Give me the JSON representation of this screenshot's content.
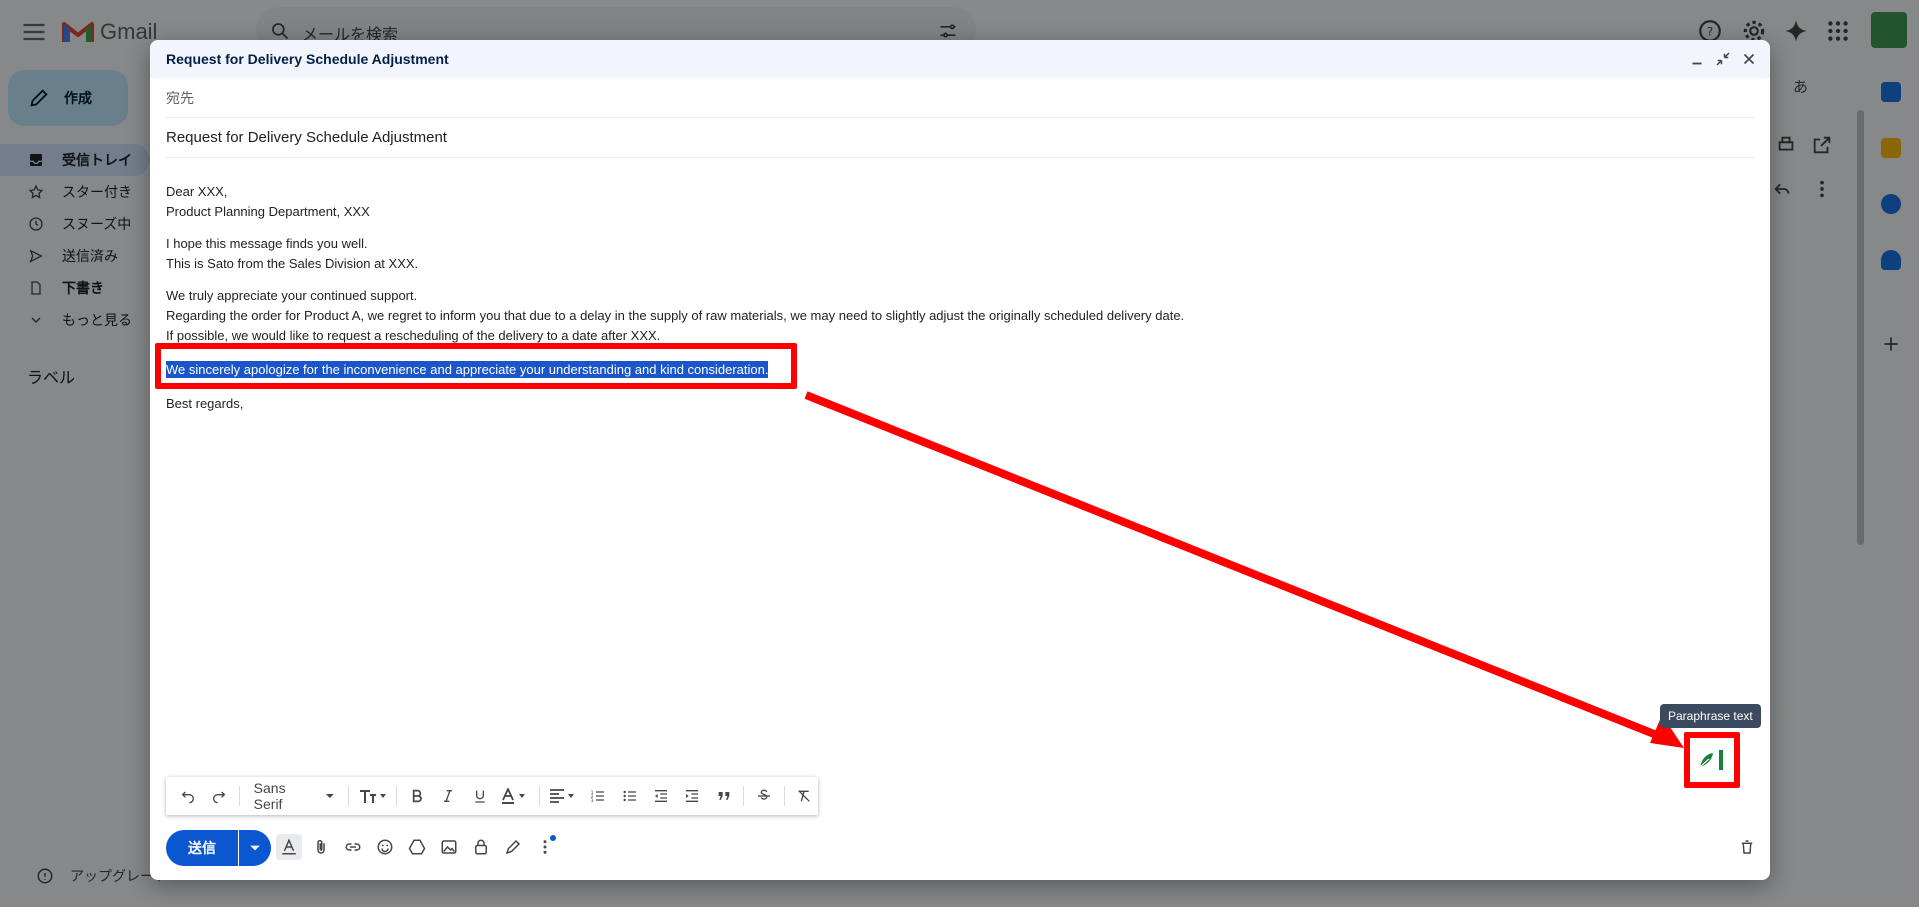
{
  "app": {
    "name": "Gmail"
  },
  "search": {
    "placeholder": "メールを検索"
  },
  "nav": {
    "compose": "作成",
    "items": [
      {
        "label": "受信トレイ",
        "icon": "inbox-icon"
      },
      {
        "label": "スター付き",
        "icon": "star-icon"
      },
      {
        "label": "スヌーズ中",
        "icon": "clock-icon"
      },
      {
        "label": "送信済み",
        "icon": "send-icon"
      },
      {
        "label": "下書き",
        "icon": "draft-icon"
      },
      {
        "label": "もっと見る",
        "icon": "chevron-down-icon"
      }
    ],
    "labels_title": "ラベル",
    "upgrade": "アップグレード"
  },
  "background": {
    "input_mode": "あ"
  },
  "compose": {
    "title": "Request for Delivery Schedule Adjustment",
    "to_label": "宛先",
    "subject": "Request for Delivery Schedule Adjustment",
    "body": {
      "p1": [
        "Dear XXX,",
        "Product Planning Department, XXX"
      ],
      "p2": [
        "I hope this message finds you well.",
        "This is Sato from the Sales Division at XXX."
      ],
      "p3": [
        "We truly appreciate your continued support.",
        "Regarding the order for Product A, we regret to inform you that due to a delay in the supply of raw materials, we may need to slightly adjust the originally scheduled delivery date.",
        "If possible, we would like to request a rescheduling of the delivery to a date after XXX."
      ],
      "highlighted": "We sincerely apologize for the inconvenience and appreciate your understanding and kind consideration.",
      "closing": "Best regards,"
    },
    "toolbar": {
      "font": "Sans Serif"
    },
    "send_label": "送信",
    "paraphrase_tooltip": "Paraphrase text"
  },
  "colors": {
    "accent": "#0b57d0",
    "annotation": "#ff0000",
    "selection": "#1a56c9"
  }
}
